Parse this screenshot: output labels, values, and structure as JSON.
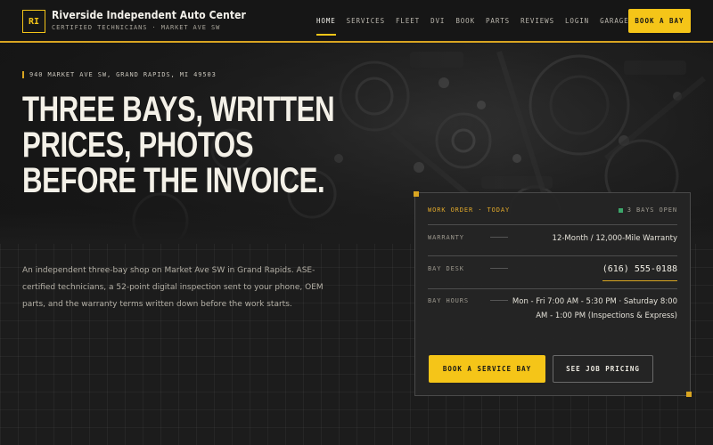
{
  "brand": {
    "initials": "RI",
    "name": "Riverside Independent Auto Center",
    "tagline": "CERTIFIED TECHNICIANS · MARKET AVE SW"
  },
  "nav": {
    "items": [
      {
        "label": "HOME",
        "active": true
      },
      {
        "label": "SERVICES",
        "active": false
      },
      {
        "label": "FLEET",
        "active": false
      },
      {
        "label": "DVI",
        "active": false
      },
      {
        "label": "BOOK",
        "active": false
      },
      {
        "label": "PARTS",
        "active": false
      },
      {
        "label": "REVIEWS",
        "active": false
      },
      {
        "label": "LOGIN",
        "active": false
      },
      {
        "label": "GARAGE",
        "active": false
      }
    ],
    "cta_label": "BOOK A BAY"
  },
  "hero": {
    "address": "940 MARKET AVE SW, GRAND RAPIDS, MI 49503",
    "headline_lines": [
      "THREE BAYS, WRITTEN",
      "PRICES, PHOTOS",
      "BEFORE THE INVOICE."
    ],
    "description": "An independent three-bay shop on Market Ave SW in Grand Rapids. ASE-certified technicians, a 52-point digital inspection sent to your phone, OEM parts, and the warranty terms written down before the work starts."
  },
  "work_order": {
    "title": "WORK ORDER · TODAY",
    "bays_status": "3 BAYS OPEN",
    "rows": [
      {
        "label": "WARRANTY",
        "value": "12-Month / 12,000-Mile Warranty"
      },
      {
        "label": "BAY DESK",
        "value": "(616) 555-0188"
      },
      {
        "label": "BAY HOURS",
        "value": "Mon - Fri 7:00 AM - 5:30 PM · Saturday 8:00 AM - 1:00 PM (Inspections & Express)"
      }
    ],
    "primary_button": "BOOK A SERVICE BAY",
    "secondary_button": "SEE JOB PRICING"
  },
  "colors": {
    "accent": "#f5c518",
    "accent_border": "#d9a521",
    "background": "#1c1c1c",
    "status_open": "#3ca66a"
  }
}
